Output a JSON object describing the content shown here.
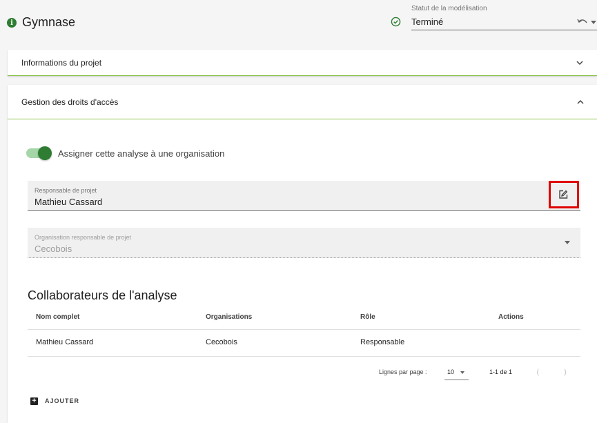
{
  "header": {
    "info_icon": "info-icon",
    "title": "Gymnase",
    "status_label": "Statut de la modélisation",
    "status_value": "Terminé",
    "status_icon": "check-circle-icon"
  },
  "project_info": {
    "title": "Informations du projet",
    "expanded": false
  },
  "access_rights": {
    "title": "Gestion des droits d'accès",
    "expanded": true,
    "toggle": {
      "label": "Assigner cette analyse à une organisation",
      "on": true
    },
    "project_manager": {
      "label": "Responsable de projet",
      "value": "Mathieu Cassard"
    },
    "organization": {
      "label": "Organisation responsable de projet",
      "value": "Cecobois",
      "disabled": true
    }
  },
  "collaborators": {
    "title": "Collaborateurs de l'analyse",
    "columns": [
      "Nom complet",
      "Organisations",
      "Rôle",
      "Actions"
    ],
    "rows": [
      {
        "name": "Mathieu Cassard",
        "organization": "Cecobois",
        "role": "Responsable"
      }
    ],
    "pagination": {
      "rows_per_page_label": "Lignes par page :",
      "rows_per_page": "10",
      "range": "1-1 de 1"
    },
    "add_label": "AJOUTER"
  },
  "colors": {
    "accent": "#2e7d32",
    "highlight": "#e00000",
    "divider": "#8bc34a"
  }
}
